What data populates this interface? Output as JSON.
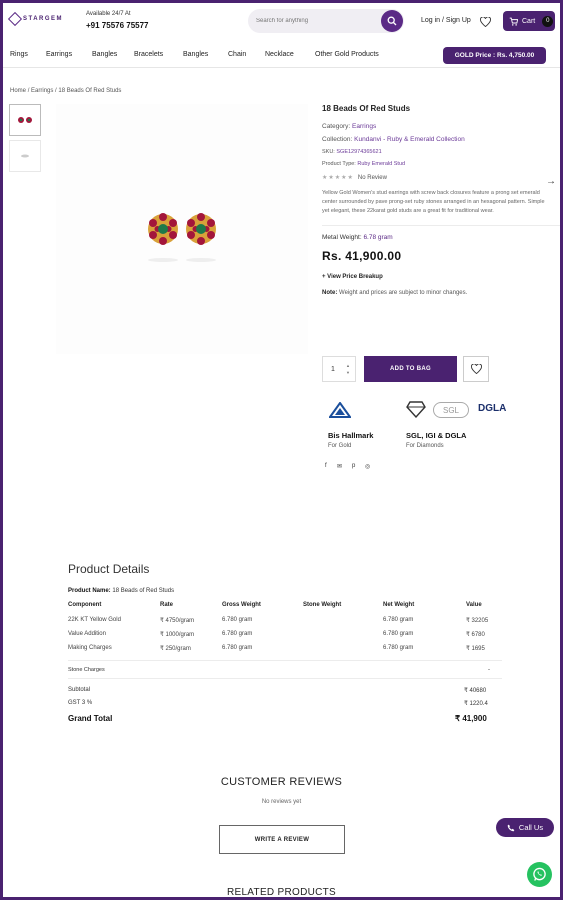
{
  "header": {
    "logo_text": "STARGEM",
    "availability": "Available 24/7 At",
    "phone": "+91 75576 75577",
    "search_placeholder": "Search for anything",
    "login_label": "Log in / Sign Up",
    "cart_label": "Cart",
    "cart_count": "0"
  },
  "nav": {
    "items": [
      "Rings",
      "Earrings",
      "Bangles",
      "Bracelets",
      "Bangles",
      "Chain",
      "Necklace",
      "Other Gold Products"
    ],
    "gold_price": "GOLD Price : Rs. 4,750.00"
  },
  "breadcrumb": [
    "Home",
    "Earrings",
    "18 Beads Of Red Studs"
  ],
  "product": {
    "title": "18 Beads Of Red Studs",
    "category_label": "Category:",
    "category": "Earrings",
    "collection_label": "Collection:",
    "collection": "Kundanvi - Ruby & Emerald Collection",
    "sku_label": "SKU:",
    "sku": "SGE12974365621",
    "type_label": "Product Type:",
    "type": "Ruby Emerald Stud",
    "stars": "★★★★★",
    "reviews": "No Review",
    "description": "Yellow Gold Women's stud earrings with screw back closures feature a prong set emerald center surrounded by pave prong-set ruby stones arranged in an hexagonal pattern. Simple yet elegant, these 22karat gold studs are a great fit for traditional wear.",
    "metal_weight_label": "Metal Weight:",
    "metal_weight": "6.78 gram",
    "price": "Rs. 41,900.00",
    "breakup_label": "+ View Price Breakup",
    "note_label": "Note:",
    "note": "Weight and prices are subject to minor changes.",
    "qty": "1",
    "add_to_bag": "ADD TO BAG"
  },
  "certifications": [
    {
      "title": "Bis Hallmark",
      "sub": "For Gold"
    },
    {
      "title": "SGL, IGI & DGLA",
      "sub": "For Diamonds"
    }
  ],
  "cert_logos": {
    "sgl": "SGL",
    "dgla": "DGLA"
  },
  "social": [
    "f",
    "✉",
    "p",
    "◎"
  ],
  "details": {
    "title": "Product Details",
    "name_label": "Product Name:",
    "name": "18 Beads of Red Studs",
    "headers": [
      "Component",
      "Rate",
      "Gross Weight",
      "Stone Weight",
      "Net Weight",
      "Value"
    ],
    "rows": [
      [
        "22K KT Yellow Gold",
        "₹ 4750/gram",
        "6.780 gram",
        "",
        "6.780 gram",
        "₹ 32205"
      ],
      [
        "Value Addition",
        "₹ 1000/gram",
        "6.780 gram",
        "",
        "6.780 gram",
        "₹ 6780"
      ],
      [
        "Making Charges",
        "₹ 250/gram",
        "6.780 gram",
        "",
        "6.780 gram",
        "₹ 1695"
      ]
    ],
    "stone_charges_label": "Stone Charges",
    "stone_charges_value": "-",
    "subtotal_label": "Subtotal",
    "subtotal": "₹ 40680",
    "gst_label": "GST 3 %",
    "gst": "₹ 1220.4",
    "grand_label": "Grand Total",
    "grand": "₹ 41,900"
  },
  "reviews": {
    "title": "CUSTOMER REVIEWS",
    "empty": "No reviews yet",
    "write": "WRITE A REVIEW"
  },
  "related_title": "RELATED PRODUCTS",
  "call_us": "Call Us",
  "colors": {
    "brand": "#4a2270",
    "accent": "#5b2a86",
    "ruby": "#a3163b",
    "emerald": "#1f7a4a",
    "gold": "#d9a13a"
  }
}
